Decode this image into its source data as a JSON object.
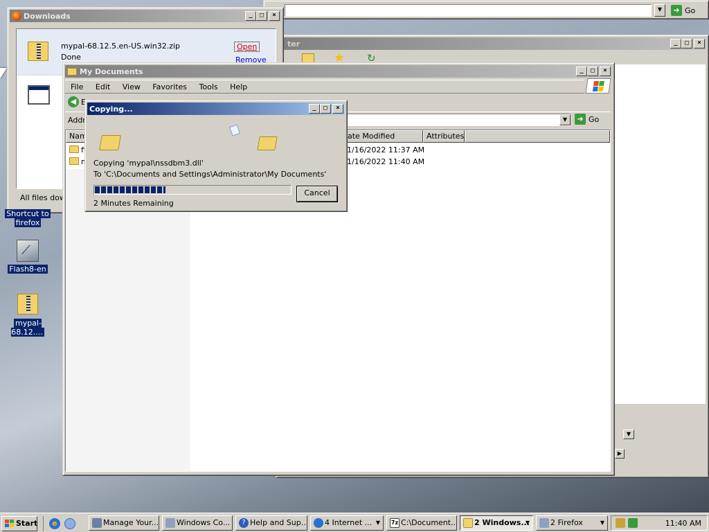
{
  "browser_bg": {
    "go_label": "Go"
  },
  "back_window": {
    "title": "ter"
  },
  "downloads": {
    "title": "Downloads",
    "item1": {
      "name": "mypal-68.12.5.en-US.win32.zip",
      "status": "Done",
      "open_link": "Open",
      "remove_link": "Remove"
    },
    "footer": "All files dow"
  },
  "my_documents": {
    "title": "My Documents",
    "menu": [
      "File",
      "Edit",
      "View",
      "Favorites",
      "Tools",
      "Help"
    ],
    "back_label": "Ba",
    "address_label": "Addr",
    "go_label": "Go",
    "columns": [
      "Nam",
      "ate Modified",
      "Attributes"
    ],
    "rows": [
      {
        "name": "ff",
        "modified": "1/16/2022 11:37 AM"
      },
      {
        "name": "m",
        "modified": "1/16/2022 11:40 AM"
      }
    ]
  },
  "copying": {
    "title": "Copying...",
    "line1": "Copying 'mypal\\nssdbm3.dll'",
    "line2": "To 'C:\\Documents and Settings\\Administrator\\My Documents'",
    "progress": 0.36,
    "remaining": "2 Minutes Remaining",
    "cancel": "Cancel"
  },
  "desktop_icons": [
    {
      "label_line1": "Shortcut to",
      "label_line2": "firefox"
    },
    {
      "label_line1": "Flash8-en",
      "label_line2": ""
    },
    {
      "label_line1": "mypal-68.12....",
      "label_line2": ""
    }
  ],
  "taskbar": {
    "start": "Start",
    "buttons": [
      {
        "label": "Manage Your...",
        "color": "#6d7fa8"
      },
      {
        "label": "Windows Co...",
        "color": "#8fa0c0"
      },
      {
        "label": "Help and Sup...",
        "color": "#2d5bbf"
      },
      {
        "label": "4 Internet ...",
        "color": "#2a6fd1"
      },
      {
        "label": "C:\\Document...",
        "color": "#444"
      },
      {
        "label": "2 Windows...",
        "color": "#f2d36b"
      },
      {
        "label": "2 Firefox",
        "color": "#8fa0c0"
      }
    ],
    "clock": "11:40 AM"
  }
}
